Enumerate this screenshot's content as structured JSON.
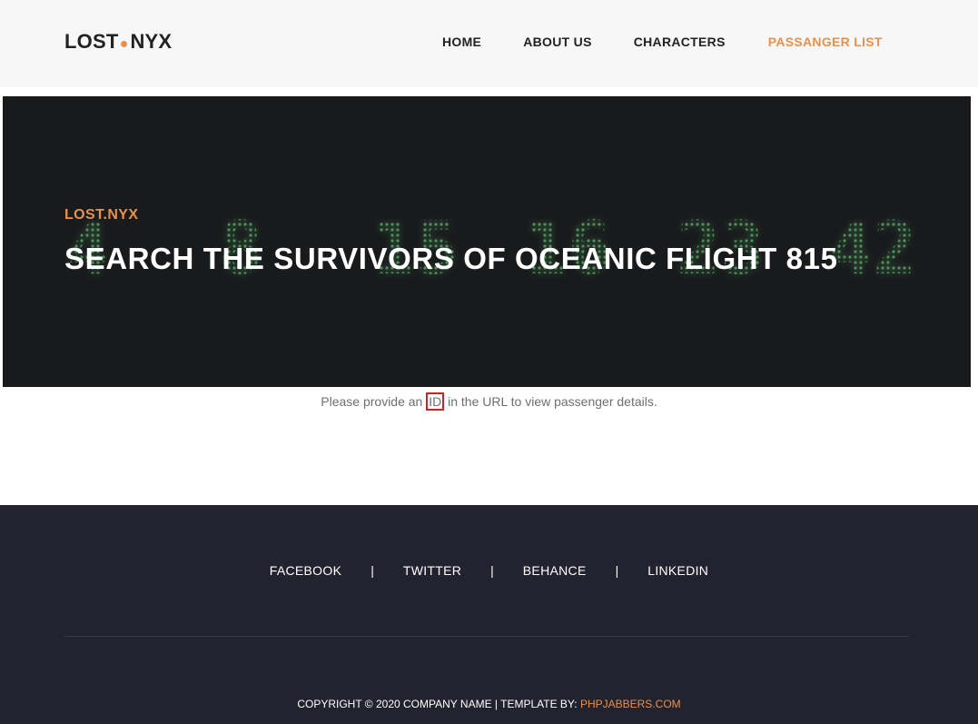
{
  "header": {
    "logo": {
      "part1": "LOST",
      "part2": "NYX",
      "dot_color": "#e8914d"
    },
    "nav": [
      {
        "label": "HOME",
        "active": false
      },
      {
        "label": "ABOUT US",
        "active": false
      },
      {
        "label": "CHARACTERS",
        "active": false
      },
      {
        "label": "PASSANGER LIST",
        "active": true
      }
    ],
    "active_color": "#e8914d"
  },
  "hero": {
    "subtitle": "LOST.NYX",
    "title": "SEARCH THE SURVIVORS OF OCEANIC FLIGHT 815",
    "background_numbers": [
      "4",
      "8",
      "15",
      "16",
      "23",
      "42"
    ]
  },
  "message": {
    "before": "Please provide an ",
    "highlight": "ID",
    "after": " in the URL to view passenger details."
  },
  "footer": {
    "social": [
      {
        "label": "FACEBOOK"
      },
      {
        "label": "TWITTER"
      },
      {
        "label": "BEHANCE"
      },
      {
        "label": "LINKEDIN"
      }
    ],
    "separator": "|",
    "copyright_text": "COPYRIGHT © 2020 COMPANY NAME | TEMPLATE BY: ",
    "copyright_link": "PHPJABBERS.COM"
  }
}
